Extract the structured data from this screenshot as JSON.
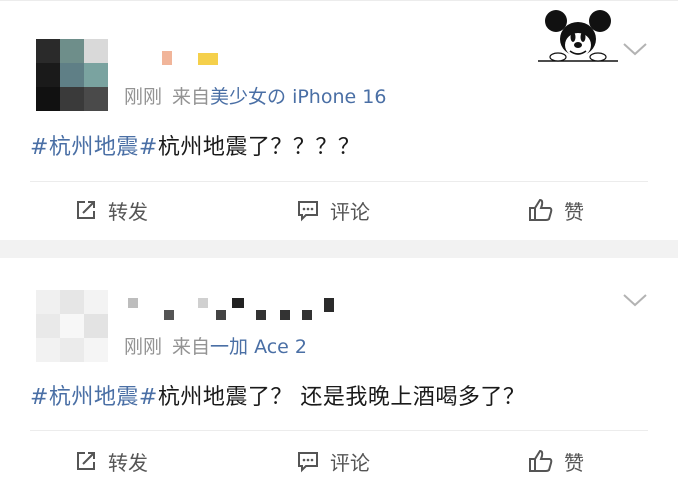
{
  "posts": [
    {
      "time": "刚刚",
      "source_prefix": "来自",
      "device": "美少女の iPhone 16",
      "hashtag": "#杭州地震#",
      "text": "杭州地震了？？？？",
      "actions": {
        "repost": "转发",
        "comment": "评论",
        "like": "赞"
      }
    },
    {
      "time": "刚刚",
      "source_prefix": "来自",
      "device": "一加 Ace 2",
      "hashtag": "#杭州地震#",
      "text": "杭州地震了？ 还是我晚上酒喝多了？",
      "actions": {
        "repost": "转发",
        "comment": "评论",
        "like": "赞"
      }
    }
  ],
  "icons": {
    "repost": "repost-icon",
    "comment": "comment-icon",
    "like": "thumbs-up-icon",
    "menu": "chevron-down-icon",
    "sticker": "mickey-mouse-sticker"
  },
  "colors": {
    "link": "#4a6fa5",
    "meta": "#939393",
    "text": "#1a1a1a",
    "separator": "#f2f2f2"
  }
}
